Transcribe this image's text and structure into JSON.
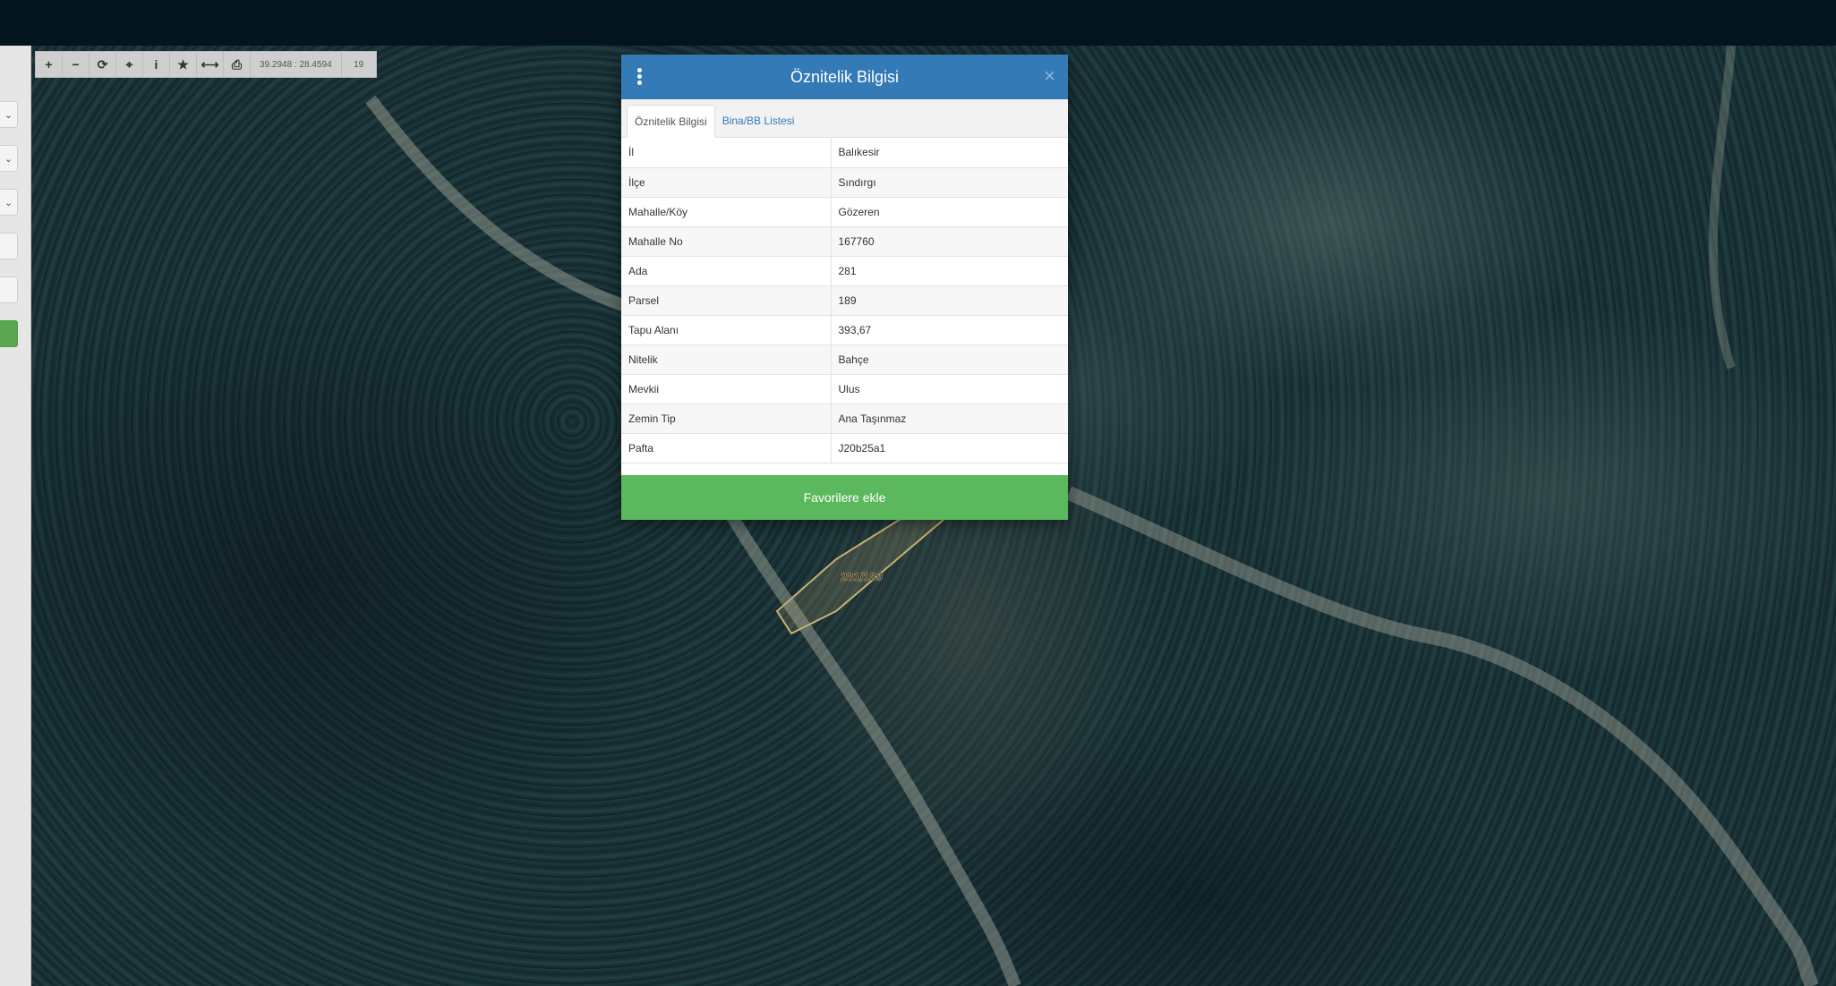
{
  "toolbar": {
    "buttons": [
      {
        "icon": "zoom-in-icon",
        "glyph": "+"
      },
      {
        "icon": "zoom-out-icon",
        "glyph": "−"
      },
      {
        "icon": "refresh-icon",
        "glyph": "⟳"
      },
      {
        "icon": "locate-icon",
        "glyph": "⌖"
      },
      {
        "icon": "info-icon",
        "glyph": "i"
      },
      {
        "icon": "star-icon",
        "glyph": "★"
      },
      {
        "icon": "measure-icon",
        "glyph": "⟷"
      },
      {
        "icon": "print-icon",
        "glyph": "⎙"
      }
    ],
    "coordinates": "39.2948 : 28.4594",
    "zoom_level": "19"
  },
  "map": {
    "parcel_label": "281/189",
    "parcel_color": "#c8b073"
  },
  "modal": {
    "title": "Öznitelik Bilgisi",
    "tabs": [
      {
        "label": "Öznitelik Bilgisi",
        "active": true
      },
      {
        "label": "Bina/BB Listesi",
        "active": false
      }
    ],
    "rows": [
      {
        "key": "İl",
        "value": "Balıkesir"
      },
      {
        "key": "İlçe",
        "value": "Sındırgı"
      },
      {
        "key": "Mahalle/Köy",
        "value": "Gözeren"
      },
      {
        "key": "Mahalle No",
        "value": "167760"
      },
      {
        "key": "Ada",
        "value": "281"
      },
      {
        "key": "Parsel",
        "value": "189"
      },
      {
        "key": "Tapu Alanı",
        "value": "393,67"
      },
      {
        "key": "Nitelik",
        "value": "Bahçe"
      },
      {
        "key": "Mevkii",
        "value": "Ulus"
      },
      {
        "key": "Zemin Tip",
        "value": "Ana Taşınmaz"
      },
      {
        "key": "Pafta",
        "value": "J20b25a1"
      }
    ],
    "favorite_button": "Favorilere ekle",
    "header_color": "#337ab7",
    "button_color": "#5cb85c"
  }
}
